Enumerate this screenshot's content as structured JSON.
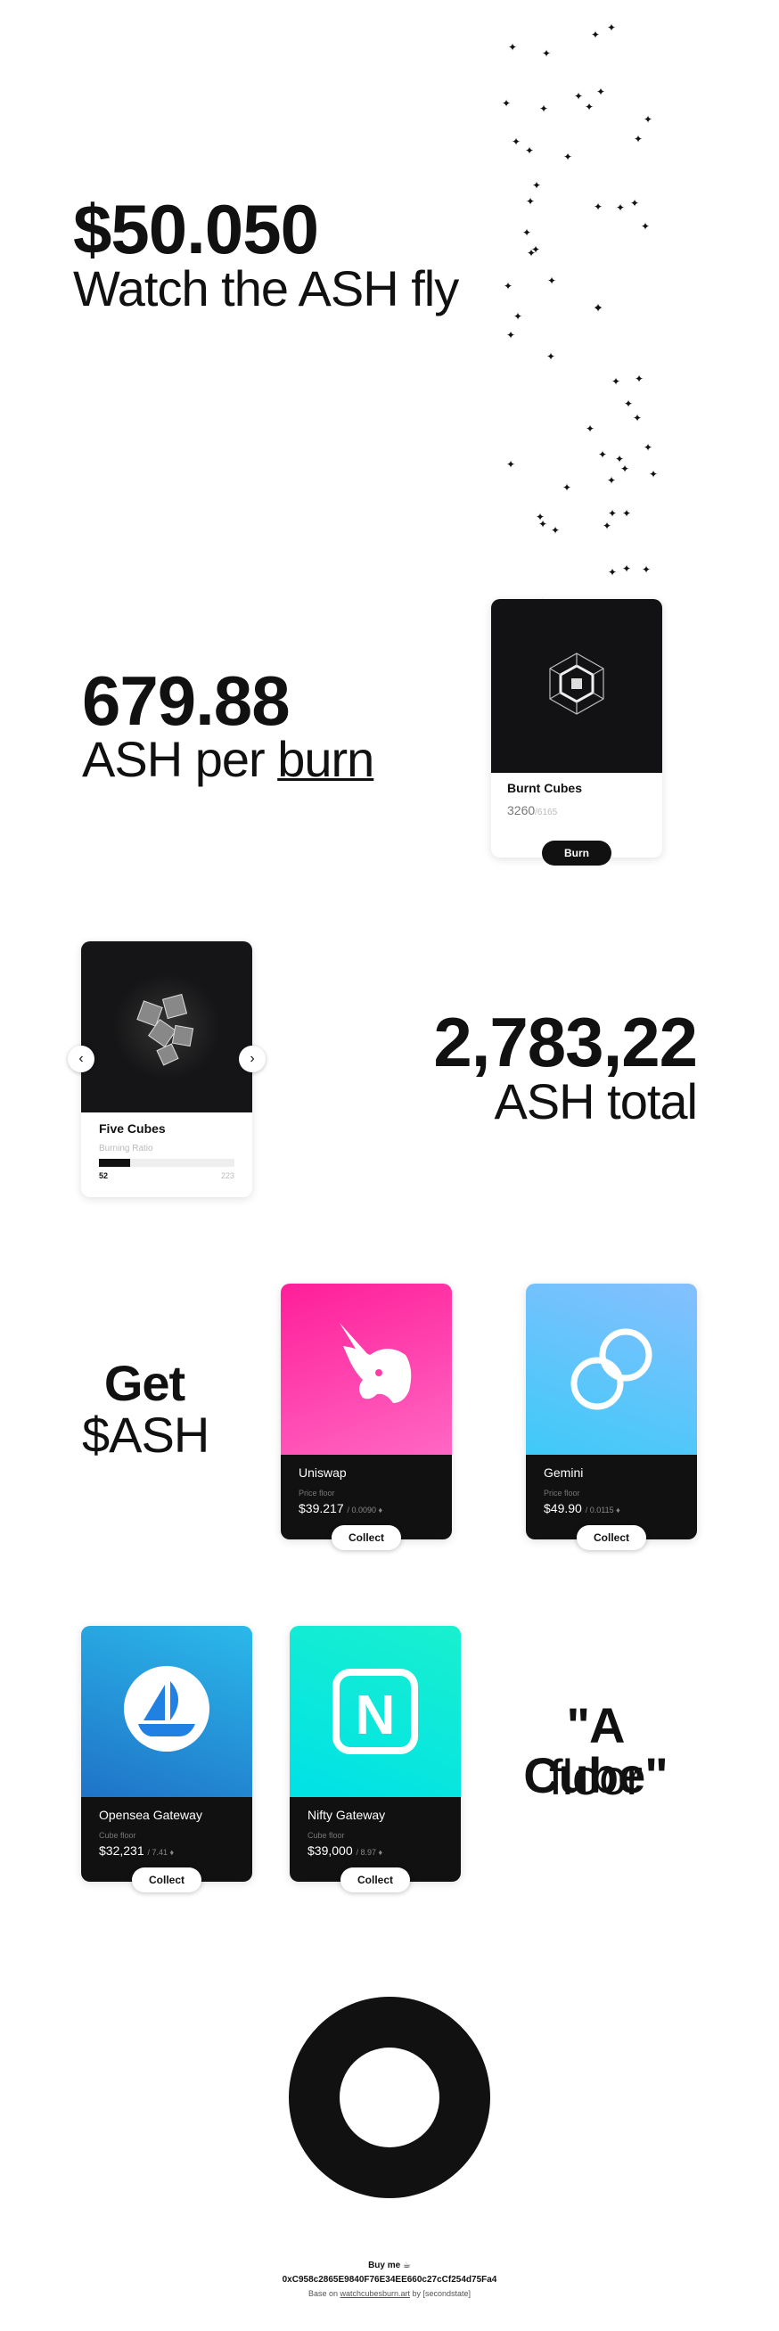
{
  "hero": {
    "price": "$50.050",
    "tagline": "Watch the ASH fly"
  },
  "burn": {
    "amount": "679.88",
    "label_prefix": "ASH per ",
    "label_link": "burn",
    "card": {
      "title": "Burnt Cubes",
      "count": "3260",
      "count_suffix": "/6165",
      "button": "Burn"
    }
  },
  "total": {
    "amount": "2,783,22",
    "label": "ASH total",
    "card": {
      "title": "Five Cubes",
      "ratio_label": "Burning Ratio",
      "ratio_value": 52,
      "ratio_max": 223,
      "ratio_value_text": "52",
      "ratio_max_text": "223",
      "prev": "‹",
      "next": "›"
    }
  },
  "get_ash": {
    "title": "Get",
    "subtitle": "$ASH",
    "exchanges": [
      {
        "name": "Uniswap",
        "label": "Price floor",
        "price": "$39.217",
        "sub": "/ 0.0090 ♦",
        "button": "Collect",
        "color_top": "#ff2d9e",
        "color_bottom": "#ff6ac2"
      },
      {
        "name": "Gemini",
        "label": "Price floor",
        "price": "$49.90",
        "sub": "/ 0.0115 ♦",
        "button": "Collect",
        "color_top": "#6ec3ff",
        "color_bottom": "#3fc8f6"
      }
    ]
  },
  "cube_floor": {
    "title": "\"A Cube\"",
    "subtitle": "floor",
    "markets": [
      {
        "name": "Opensea Gateway",
        "label": "Cube floor",
        "price": "$32,231",
        "sub": "/ 7.41 ♦",
        "button": "Collect"
      },
      {
        "name": "Nifty Gateway",
        "label": "Cube floor",
        "price": "$39,000",
        "sub": "/ 8.97 ♦",
        "button": "Collect"
      }
    ]
  },
  "footer": {
    "buy_me": "Buy me ☕",
    "address": "0xC958c2865E9840F76E34EE660c27cCf254d75Fa4",
    "credit_prefix": "Base on ",
    "credit_link": "watchcubesburn.art",
    "credit_suffix": " by [secondstate]"
  },
  "icons": {
    "sparkle": "✦",
    "uniswap": "unicorn-icon",
    "gemini": "gemini-logo-icon",
    "opensea": "opensea-boat-icon",
    "nifty": "nifty-n-icon"
  }
}
